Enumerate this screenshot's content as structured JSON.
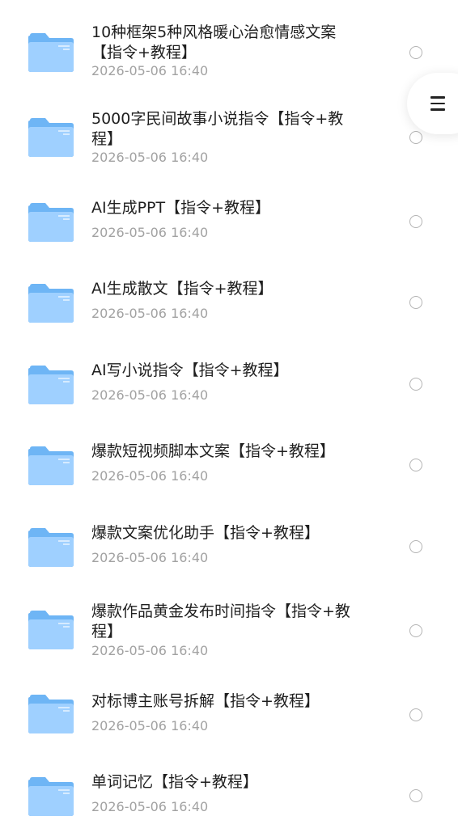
{
  "files": [
    {
      "title": "10种框架5种风格暖心治愈情感文案【指令+教程】",
      "date": "2026-05-06 16:40"
    },
    {
      "title": "5000字民间故事小说指令【指令+教程】",
      "date": "2026-05-06 16:40"
    },
    {
      "title": "AI生成PPT【指令+教程】",
      "date": "2026-05-06 16:40"
    },
    {
      "title": "AI生成散文【指令+教程】",
      "date": "2026-05-06 16:40"
    },
    {
      "title": "AI写小说指令【指令+教程】",
      "date": "2026-05-06 16:40"
    },
    {
      "title": "爆款短视频脚本文案【指令+教程】",
      "date": "2026-05-06 16:40"
    },
    {
      "title": "爆款文案优化助手【指令+教程】",
      "date": "2026-05-06 16:40"
    },
    {
      "title": "爆款作品黄金发布时间指令【指令+教程】",
      "date": "2026-05-06 16:40"
    },
    {
      "title": "对标博主账号拆解【指令+教程】",
      "date": "2026-05-06 16:40"
    },
    {
      "title": "单词记忆【指令+教程】",
      "date": "2026-05-06 16:40"
    }
  ],
  "icons": {
    "folder": "folder-icon",
    "menu": "menu-icon",
    "select": "radio-unchecked"
  },
  "colors": {
    "folder_light": "#a9d6ff",
    "folder_dark": "#5eaaf2",
    "title_text": "#1f1f1f",
    "date_text": "#a2a2a2",
    "radio_border": "#b4b4b4"
  }
}
